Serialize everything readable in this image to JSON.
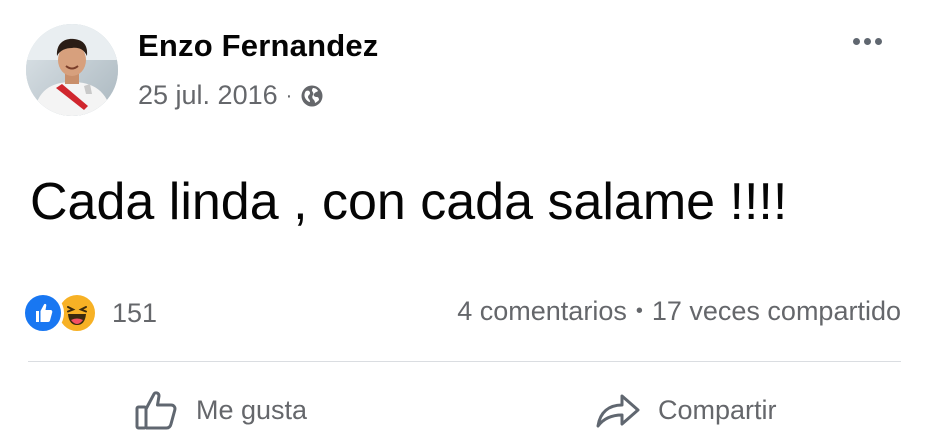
{
  "post": {
    "author": "Enzo Fernandez",
    "date": "25 jul. 2016",
    "separator": "·",
    "audience_icon": "globe-icon",
    "message": "Cada linda , con cada salame !!!!"
  },
  "reactions": {
    "icons": [
      "like-reaction-icon",
      "haha-reaction-icon"
    ],
    "count": "151"
  },
  "stats": {
    "comments": "4 comentarios",
    "separator": "•",
    "shares": "17 veces compartido"
  },
  "actions": {
    "like_label": "Me gusta",
    "share_label": "Compartir"
  },
  "colors": {
    "like_blue": "#1877f2",
    "haha_yellow": "#f7b125",
    "secondary_text": "#65676b",
    "divider": "#dadde1"
  }
}
